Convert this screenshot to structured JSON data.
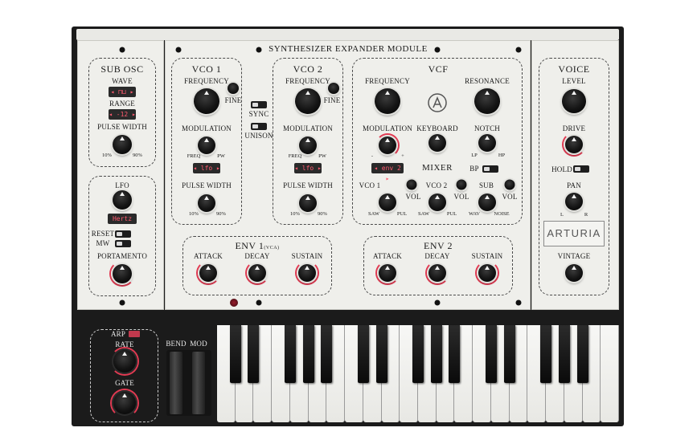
{
  "title": "SYNTHESIZER EXPANDER MODULE",
  "sub_osc": {
    "title": "SUB OSC",
    "wave_label": "WAVE",
    "range_label": "RANGE",
    "range_value": "-12",
    "pulse_width_label": "PULSE WIDTH",
    "pw_min": "10%",
    "pw_max": "90%"
  },
  "lfo": {
    "title": "LFO",
    "rate_value": "Hertz",
    "reset_label": "RESET",
    "mw_label": "MW",
    "portamento_label": "PORTAMENTO"
  },
  "vco1": {
    "title": "VCO 1",
    "frequency_label": "FREQUENCY",
    "fine_label": "FINE",
    "modulation_label": "MODULATION",
    "freq_label": "FREQ",
    "pw_label": "PW",
    "mod_source": "lfo",
    "pulse_width_label": "PULSE WIDTH",
    "pw_min": "10%",
    "pw_max": "90%"
  },
  "sync_label": "SYNC",
  "unison_label": "UNISON",
  "vco2": {
    "title": "VCO 2",
    "frequency_label": "FREQUENCY",
    "fine_label": "FINE",
    "modulation_label": "MODULATION",
    "freq_label": "FREQ",
    "pw_label": "PW",
    "mod_source": "lfo",
    "pulse_width_label": "PULSE WIDTH",
    "pw_min": "10%",
    "pw_max": "90%"
  },
  "vcf": {
    "title": "VCF",
    "frequency_label": "FREQUENCY",
    "resonance_label": "RESONANCE",
    "modulation_label": "MODULATION",
    "mod_source": "env 2",
    "keyboard_label": "KEYBOARD",
    "notch_label": "NOTCH",
    "lp_label": "LP",
    "hp_label": "HP",
    "bp_label": "BP"
  },
  "mixer": {
    "title": "MIXER",
    "vco1_label": "VCO 1",
    "vco2_label": "VCO 2",
    "sub_label": "SUB",
    "vol_label": "VOL",
    "saw_label": "SAW",
    "pul_label": "PUL",
    "wav_label": "WAV",
    "noise_label": "NOISE"
  },
  "env1": {
    "title": "ENV 1",
    "subtitle": "(VCA)",
    "attack_label": "ATTACK",
    "decay_label": "DECAY",
    "sustain_label": "SUSTAIN"
  },
  "env2": {
    "title": "ENV 2",
    "attack_label": "ATTACK",
    "decay_label": "DECAY",
    "sustain_label": "SUSTAIN"
  },
  "voice": {
    "title": "VOICE",
    "level_label": "LEVEL",
    "drive_label": "DRIVE",
    "hold_label": "HOLD",
    "pan_label": "PAN",
    "pan_l": "L",
    "pan_r": "R",
    "brand": "ARTURIA",
    "vintage_label": "VINTAGE"
  },
  "arp": {
    "title": "ARP",
    "rate_label": "RATE",
    "gate_label": "GATE"
  },
  "wheels": {
    "bend_label": "BEND",
    "mod_label": "MOD"
  },
  "colors": {
    "panel": "#efefeb",
    "body": "#1b1b1b",
    "accent": "#e23a52",
    "lcd_text": "#ff5a6e"
  }
}
